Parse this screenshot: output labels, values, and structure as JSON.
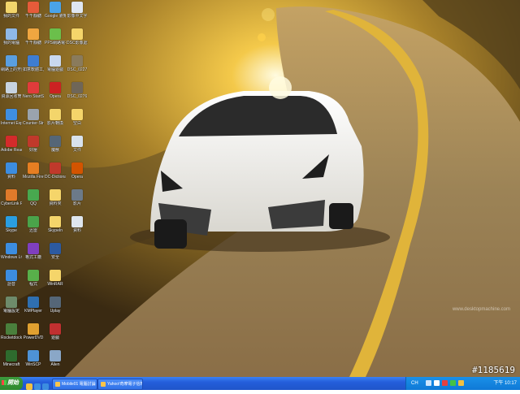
{
  "desktop": {
    "wallpaper_credit": "www.desktopmachine.com",
    "watermark": "#1185619",
    "icons": [
      {
        "label": "我的文件",
        "color": "#f2d56b"
      },
      {
        "label": "千千靜聽",
        "color": "#e55b3a"
      },
      {
        "label": "Google 瀏覽器",
        "color": "#4aa3e8"
      },
      {
        "label": "影像中文字",
        "color": "#dfe6f0"
      },
      {
        "label": "我的電腦",
        "color": "#8fb8e6"
      },
      {
        "label": "千千靜聽",
        "color": "#f0a640"
      },
      {
        "label": "PPS網路電視",
        "color": "#6bbf4b"
      },
      {
        "label": "DSC影像處理",
        "color": "#f5d56a"
      },
      {
        "label": "網路上的芳鄰",
        "color": "#5a9fe0"
      },
      {
        "label": "如意軟體工具",
        "color": "#3e7dd1"
      },
      {
        "label": "電腦遊戲",
        "color": "#c9d8ef"
      },
      {
        "label": "DSC_0227",
        "color": "#8a7b5c"
      },
      {
        "label": "資源回收筒",
        "color": "#c7d3e1"
      },
      {
        "label": "Nero StartSmart",
        "color": "#e13b3b"
      },
      {
        "label": "Opera",
        "color": "#cc2222"
      },
      {
        "label": "DSC_0276",
        "color": "#6f6658"
      },
      {
        "label": "Internet Explorer",
        "color": "#3f8ee0"
      },
      {
        "label": "Counter-Strike Online",
        "color": "#9aa3ad"
      },
      {
        "label": "影片轉換",
        "color": "#f3d56b"
      },
      {
        "label": "空白",
        "color": "#f5d56a"
      },
      {
        "label": "Adobe Reader 9",
        "color": "#d42b2b"
      },
      {
        "label": "好壓",
        "color": "#c0392b"
      },
      {
        "label": "魔獸",
        "color": "#556677"
      },
      {
        "label": "文件",
        "color": "#d8e2ee"
      },
      {
        "label": "資料",
        "color": "#3c8de0"
      },
      {
        "label": "Mozilla Firefox",
        "color": "#e67e22"
      },
      {
        "label": "DC-Dictionary",
        "color": "#c0392b"
      },
      {
        "label": "Opera",
        "color": "#d35400"
      },
      {
        "label": "CyberLink PowerDVD",
        "color": "#e07a2a"
      },
      {
        "label": "QQ",
        "color": "#48a84f"
      },
      {
        "label": "資料夾",
        "color": "#f5d56a"
      },
      {
        "label": "影片",
        "color": "#6c7a89"
      },
      {
        "label": "Skype",
        "color": "#2a9ee0"
      },
      {
        "label": "迅雷",
        "color": "#4aa34a"
      },
      {
        "label": "SkypeIn",
        "color": "#f5d56a"
      },
      {
        "label": "資料",
        "color": "#dfe6ee"
      },
      {
        "label": "Windows Live",
        "color": "#3c8de0"
      },
      {
        "label": "格式工廠",
        "color": "#7f3fbf"
      },
      {
        "label": "安全",
        "color": "#2c5aa0"
      },
      {
        "label": "",
        "color": "#000000"
      },
      {
        "label": "語音",
        "color": "#3c8de0"
      },
      {
        "label": "程式",
        "color": "#58b04a"
      },
      {
        "label": "WinRAR",
        "color": "#f5d56a"
      },
      {
        "label": "",
        "color": "#000000"
      },
      {
        "label": "電腦設定",
        "color": "#6e8b6b"
      },
      {
        "label": "KMPlayer",
        "color": "#2f6fb0"
      },
      {
        "label": "Uplay",
        "color": "#556677"
      },
      {
        "label": "",
        "color": "#000000"
      },
      {
        "label": "Rocketdock",
        "color": "#4a7f3c"
      },
      {
        "label": "PowerDVD",
        "color": "#e0a030"
      },
      {
        "label": "遊戲",
        "color": "#c03030"
      },
      {
        "label": "",
        "color": "#000000"
      },
      {
        "label": "Minecraft",
        "color": "#2e6b2e"
      },
      {
        "label": "WinSCP",
        "color": "#4e92d6"
      },
      {
        "label": "Alien",
        "color": "#8aa7c7"
      },
      {
        "label": "",
        "color": "#000000"
      }
    ]
  },
  "taskbar": {
    "start_label": "開始",
    "quick_launch": [
      "#f0c040",
      "#3b8fe0",
      "#3c8de0"
    ],
    "tasks": [
      {
        "label": "Mobile01 電腦討論"
      },
      {
        "label": "Yahoo!奇摩電子信箱"
      }
    ],
    "tray": {
      "lang": "CH",
      "clock": "下午 10:17"
    }
  }
}
